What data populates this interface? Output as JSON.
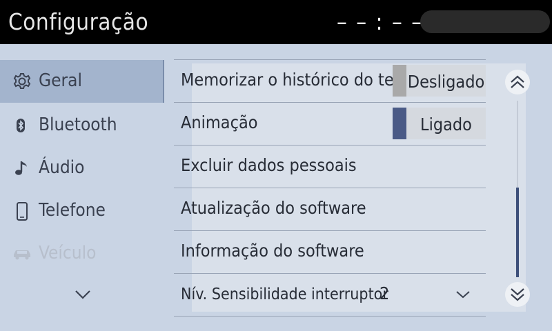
{
  "header": {
    "title": "Configuração",
    "clock": "– – : – –"
  },
  "sidebar": {
    "items": [
      {
        "label": "Geral",
        "icon": "gear-icon",
        "selected": true
      },
      {
        "label": "Bluetooth",
        "icon": "bluetooth-icon"
      },
      {
        "label": "Áudio",
        "icon": "music-note-icon"
      },
      {
        "label": "Telefone",
        "icon": "phone-icon"
      },
      {
        "label": "Veículo",
        "icon": "car-icon",
        "disabled": true
      }
    ],
    "more_icon": "chevron-down-icon"
  },
  "settings": {
    "rows": [
      {
        "label": "Memorizar o histórico do teclado",
        "toggle": "Desligado",
        "on": false
      },
      {
        "label": "Animação",
        "toggle": "Ligado",
        "on": true
      },
      {
        "label": "Excluir dados pessoais"
      },
      {
        "label": "Atualização do software"
      },
      {
        "label": "Informação do software"
      },
      {
        "label": "Nív. Sensibilidade interruptor",
        "value": "2"
      }
    ]
  },
  "scroll": {
    "up_icon": "double-chevron-up-icon",
    "down_icon": "double-chevron-down-icon"
  },
  "colors": {
    "header_bg": "#000000",
    "bg": "#c9d4e4",
    "selected_bg": "#a3b4cd",
    "toggle_on": "#4a5a86",
    "toggle_off": "#a9a9a9"
  }
}
